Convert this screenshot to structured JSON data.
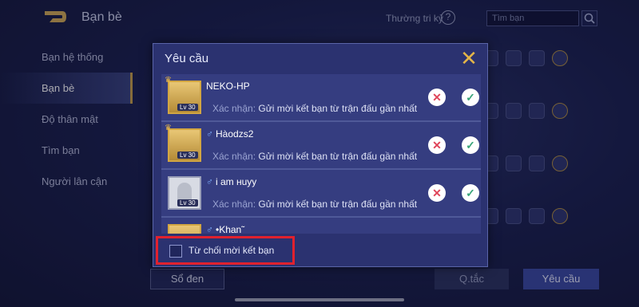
{
  "header": {
    "title": "Bạn bè",
    "guide_label": "Thường tri kỷ",
    "search_placeholder": "Tìm bạn"
  },
  "sidebar": {
    "items": [
      {
        "label": "Bạn hệ thống"
      },
      {
        "label": "Bạn bè"
      },
      {
        "label": "Độ thân mật"
      },
      {
        "label": "Tìm bạn"
      },
      {
        "label": "Người lân cận"
      }
    ]
  },
  "bottom_bar": {
    "blacklist_label": "Sổ đen",
    "rules_label": "Q.tắc",
    "requests_label": "Yêu cầu"
  },
  "modal": {
    "title": "Yêu cầu",
    "close_icon": "close-icon",
    "requests": [
      {
        "name": "NEKO-HP",
        "level": "Lv 30",
        "gender": "",
        "note_label": "Xác nhận:",
        "note_text": "Gửi mời kết bạn từ trận đấu gần nhất"
      },
      {
        "name": "Hàodzs2",
        "level": "Lv 30",
        "gender": "♂",
        "note_label": "Xác nhận:",
        "note_text": "Gửi mời kết bạn từ trận đấu gần nhất"
      },
      {
        "name": "i  am  нuyy",
        "level": "Lv 30",
        "gender": "♂",
        "note_label": "Xác nhận:",
        "note_text": "Gửi mời kết bạn từ trận đấu gần nhất"
      },
      {
        "name": "•Khan˜",
        "level": "",
        "gender": "♂",
        "note_label": "",
        "note_text": ""
      }
    ],
    "reject_all_label": "Từ chối mời kết bạn"
  },
  "colors": {
    "accent_gold": "#e4b548",
    "reject_red": "#e0455a",
    "accept_green": "#3aa57a",
    "highlight_red": "#e0212e"
  }
}
